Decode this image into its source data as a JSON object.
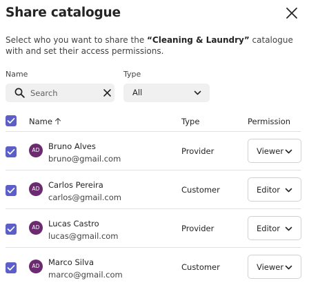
{
  "dialog": {
    "title": "Share catalogue",
    "description_pre": "Select who you want to share the ",
    "catalogue_name": "“Cleaning & Laundry”",
    "description_post": " catalogue with and set their access permissions."
  },
  "filters": {
    "name_label": "Name",
    "search_placeholder": "Search",
    "search_value": "",
    "type_label": "Type",
    "type_value": "All"
  },
  "table": {
    "headers": {
      "name": "Name",
      "type": "Type",
      "permission": "Permission"
    },
    "select_all_checked": true,
    "rows": [
      {
        "initials": "AD",
        "name": "Bruno Alves",
        "email": "bruno@gmail.com",
        "type": "Provider",
        "permission": "Viewer",
        "checked": true
      },
      {
        "initials": "AD",
        "name": "Carlos Pereira",
        "email": "carlos@gmail.com",
        "type": "Customer",
        "permission": "Editor",
        "checked": true
      },
      {
        "initials": "AD",
        "name": "Lucas Castro",
        "email": "lucas@gmail.com",
        "type": "Provider",
        "permission": "Editor",
        "checked": true
      },
      {
        "initials": "AD",
        "name": "Marco Silva",
        "email": "marco@gmail.com",
        "type": "Customer",
        "permission": "Viewer",
        "checked": true
      }
    ]
  },
  "colors": {
    "accent": "#5b5fc7",
    "avatar": "#6c2a71",
    "divider": "#e0e0e0",
    "input_bg": "#f0f0f0"
  },
  "icons": {
    "close": "close-icon",
    "search": "search-icon",
    "clear": "clear-icon",
    "chevron": "chevron-down-icon",
    "sort": "arrow-up-icon",
    "check": "checkmark-icon"
  }
}
